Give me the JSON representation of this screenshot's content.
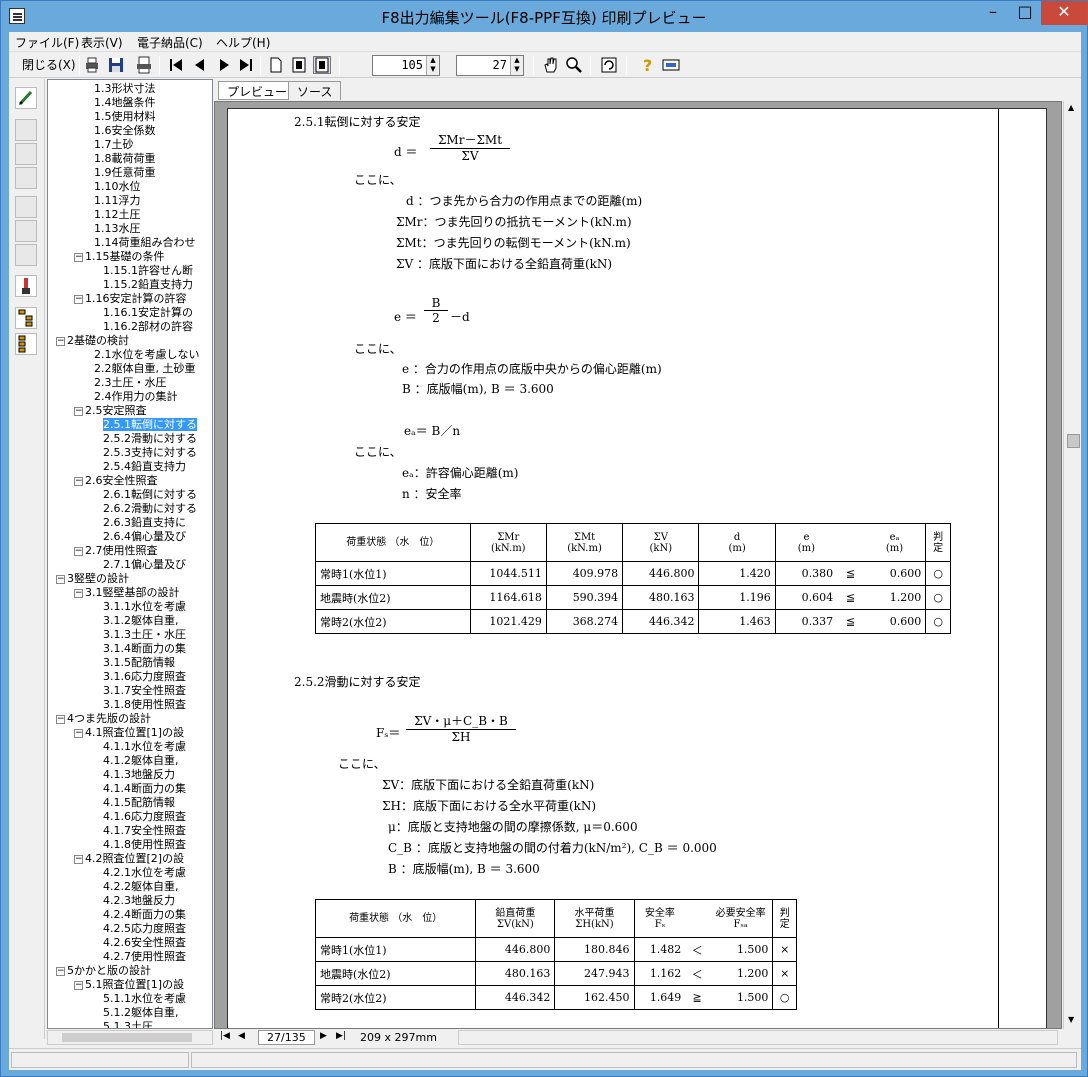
{
  "window": {
    "title": "F8出力編集ツール(F8-PPF互換) 印刷プレビュー"
  },
  "menu": [
    "ファイル(F)",
    "表示(V)",
    "電子納品(C)",
    "ヘルプ(H)"
  ],
  "toolbar": {
    "close_label": "閉じる(X)",
    "zoom": "105",
    "page": "27"
  },
  "tabs": [
    "プレビュー",
    "ソース"
  ],
  "tree": [
    {
      "label": "1.3形状寸法",
      "indent": 3
    },
    {
      "label": "1.4地盤条件",
      "indent": 3
    },
    {
      "label": "1.5使用材料",
      "indent": 3
    },
    {
      "label": "1.6安全係数",
      "indent": 3
    },
    {
      "label": "1.7土砂",
      "indent": 3
    },
    {
      "label": "1.8載荷荷重",
      "indent": 3
    },
    {
      "label": "1.9任意荷重",
      "indent": 3
    },
    {
      "label": "1.10水位",
      "indent": 3
    },
    {
      "label": "1.11浮力",
      "indent": 3
    },
    {
      "label": "1.12土圧",
      "indent": 3
    },
    {
      "label": "1.13水圧",
      "indent": 3
    },
    {
      "label": "1.14荷重組み合わせ",
      "indent": 3
    },
    {
      "label": "1.15基礎の条件",
      "indent": 2,
      "pm": "－"
    },
    {
      "label": "1.15.1許容せん断",
      "indent": 4
    },
    {
      "label": "1.15.2鉛直支持力",
      "indent": 4
    },
    {
      "label": "1.16安定計算の許容",
      "indent": 2,
      "pm": "－"
    },
    {
      "label": "1.16.1安定計算の",
      "indent": 4
    },
    {
      "label": "1.16.2部材の許容",
      "indent": 4
    },
    {
      "label": "2基礎の検討",
      "indent": 0,
      "pm": "－"
    },
    {
      "label": "2.1水位を考慮しない",
      "indent": 3
    },
    {
      "label": "2.2躯体自重, 土砂重",
      "indent": 3
    },
    {
      "label": "2.3土圧・水圧",
      "indent": 3
    },
    {
      "label": "2.4作用力の集計",
      "indent": 3
    },
    {
      "label": "2.5安定照査",
      "indent": 2,
      "pm": "－"
    },
    {
      "label": "2.5.1転倒に対する",
      "indent": 4,
      "sel": true
    },
    {
      "label": "2.5.2滑動に対する",
      "indent": 4
    },
    {
      "label": "2.5.3支持に対する",
      "indent": 4
    },
    {
      "label": "2.5.4鉛直支持力",
      "indent": 4
    },
    {
      "label": "2.6安全性照査",
      "indent": 2,
      "pm": "－"
    },
    {
      "label": "2.6.1転倒に対する",
      "indent": 4
    },
    {
      "label": "2.6.2滑動に対する",
      "indent": 4
    },
    {
      "label": "2.6.3鉛直支持に",
      "indent": 4
    },
    {
      "label": "2.6.4偏心量及び",
      "indent": 4
    },
    {
      "label": "2.7使用性照査",
      "indent": 2,
      "pm": "－"
    },
    {
      "label": "2.7.1偏心量及び",
      "indent": 4
    },
    {
      "label": "3竪壁の設計",
      "indent": 0,
      "pm": "－"
    },
    {
      "label": "3.1竪壁基部の設計",
      "indent": 2,
      "pm": "－"
    },
    {
      "label": "3.1.1水位を考慮",
      "indent": 4
    },
    {
      "label": "3.1.2躯体自重,",
      "indent": 4
    },
    {
      "label": "3.1.3土圧・水圧",
      "indent": 4
    },
    {
      "label": "3.1.4断面力の集",
      "indent": 4
    },
    {
      "label": "3.1.5配筋情報",
      "indent": 4
    },
    {
      "label": "3.1.6応力度照査",
      "indent": 4
    },
    {
      "label": "3.1.7安全性照査",
      "indent": 4
    },
    {
      "label": "3.1.8使用性照査",
      "indent": 4
    },
    {
      "label": "4つま先版の設計",
      "indent": 0,
      "pm": "－"
    },
    {
      "label": "4.1照査位置[1]の設",
      "indent": 2,
      "pm": "－"
    },
    {
      "label": "4.1.1水位を考慮",
      "indent": 4
    },
    {
      "label": "4.1.2躯体自重,",
      "indent": 4
    },
    {
      "label": "4.1.3地盤反力",
      "indent": 4
    },
    {
      "label": "4.1.4断面力の集",
      "indent": 4
    },
    {
      "label": "4.1.5配筋情報",
      "indent": 4
    },
    {
      "label": "4.1.6応力度照査",
      "indent": 4
    },
    {
      "label": "4.1.7安全性照査",
      "indent": 4
    },
    {
      "label": "4.1.8使用性照査",
      "indent": 4
    },
    {
      "label": "4.2照査位置[2]の設",
      "indent": 2,
      "pm": "－"
    },
    {
      "label": "4.2.1水位を考慮",
      "indent": 4
    },
    {
      "label": "4.2.2躯体自重,",
      "indent": 4
    },
    {
      "label": "4.2.3地盤反力",
      "indent": 4
    },
    {
      "label": "4.2.4断面力の集",
      "indent": 4
    },
    {
      "label": "4.2.5応力度照査",
      "indent": 4
    },
    {
      "label": "4.2.6安全性照査",
      "indent": 4
    },
    {
      "label": "4.2.7使用性照査",
      "indent": 4
    },
    {
      "label": "5かかと版の設計",
      "indent": 0,
      "pm": "－"
    },
    {
      "label": "5.1照査位置[1]の設",
      "indent": 2,
      "pm": "－"
    },
    {
      "label": "5.1.1水位を考慮",
      "indent": 4
    },
    {
      "label": "5.1.2躯体自重,",
      "indent": 4
    },
    {
      "label": "5.1.3土圧",
      "indent": 4
    }
  ],
  "doc": {
    "s1_title": "2.5.1転倒に対する安定",
    "d_lhs": "d ＝",
    "d_num": "ΣMr－ΣMt",
    "d_den": "ΣV",
    "here1": "ここに、",
    "def_d": "d ：つま先から合力の作用点までの距離(m)",
    "def_mr": "ΣMr：つま先回りの抵抗モーメント(kN.m)",
    "def_mt": "ΣMt：つま先回りの転倒モーメント(kN.m)",
    "def_v": "ΣV ：底版下面における全鉛直荷重(kN)",
    "e_lhs": "e ＝",
    "e_num": "B",
    "e_den": "2",
    "e_rest": "－d",
    "here2": "ここに、",
    "def_e": "e ：合力の作用点の底版中央からの偏心距離(m)",
    "def_b": "B ：底版幅(m), B ＝ 3.600",
    "ea_eq": "eₐ＝ B／n",
    "here3": "ここに、",
    "def_ea": "eₐ：許容偏心距離(m)",
    "def_n": "n ：安全率",
    "t1_headers": [
      "荷重状態 （水　位）",
      "ΣMr\n(kN.m)",
      "ΣMt\n(kN.m)",
      "ΣV\n(kN)",
      "d\n(m)",
      "e\n(m)",
      "",
      "eₐ\n(m)",
      "判\n定"
    ],
    "t1_rows": [
      [
        "常時1(水位1)",
        "1044.511",
        "409.978",
        "446.800",
        "1.420",
        "0.380",
        "≦",
        "0.600",
        "○"
      ],
      [
        "地震時(水位2)",
        "1164.618",
        "590.394",
        "480.163",
        "1.196",
        "0.604",
        "≦",
        "1.200",
        "○"
      ],
      [
        "常時2(水位2)",
        "1021.429",
        "368.274",
        "446.342",
        "1.463",
        "0.337",
        "≦",
        "0.600",
        "○"
      ]
    ],
    "s2_title": "2.5.2滑動に対する安定",
    "fs_lhs": "Fₛ＝",
    "fs_num": "ΣV・μ＋C_B・B",
    "fs_den": "ΣH",
    "here4": "ここに、",
    "def_sv": "ΣV：底版下面における全鉛直荷重(kN)",
    "def_sh": "ΣH：底版下面における全水平荷重(kN)",
    "def_mu": "μ：底版と支持地盤の間の摩擦係数, μ＝0.600",
    "def_cb": "C_B ：底版と支持地盤の間の付着力(kN/m²), C_B ＝ 0.000",
    "def_b2": "B ：底版幅(m), B ＝ 3.600",
    "t2_headers": [
      "荷重状態 （水　位）",
      "鉛直荷重\nΣV(kN)",
      "水平荷重\nΣH(kN)",
      "安全率\nFₛ",
      "",
      "必要安全率\nFₛₐ",
      "判\n定"
    ],
    "t2_rows": [
      [
        "常時1(水位1)",
        "446.800",
        "180.846",
        "1.482",
        "＜",
        "1.500",
        "×"
      ],
      [
        "地震時(水位2)",
        "480.163",
        "247.943",
        "1.162",
        "＜",
        "1.200",
        "×"
      ],
      [
        "常時2(水位2)",
        "446.342",
        "162.450",
        "1.649",
        "≧",
        "1.500",
        "○"
      ]
    ]
  },
  "status": {
    "page_info": "27/135",
    "paper": "209 x 297mm"
  }
}
